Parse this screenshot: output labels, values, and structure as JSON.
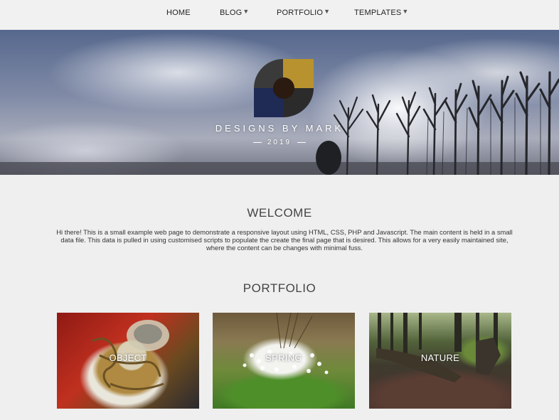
{
  "nav": {
    "items": [
      {
        "label": "HOME",
        "has_dropdown": false
      },
      {
        "label": "BLOG",
        "has_dropdown": true
      },
      {
        "label": "PORTFOLIO",
        "has_dropdown": true
      },
      {
        "label": "TEMPLATES",
        "has_dropdown": true
      }
    ],
    "dropdown_glyph": "▼"
  },
  "hero": {
    "brand": "DESIGNS BY MARK",
    "year": "2019",
    "logo_colors": [
      "#3a3a3a",
      "#b8922e",
      "#1f2a55",
      "#2b2b2b"
    ]
  },
  "welcome": {
    "title": "WELCOME",
    "text": "Hi there! This is a small example web page to demonstrate a responsive layout using HTML, CSS, PHP and Javascript. The main content is held in a small data file. This data is pulled in using customised scripts to populate the create the final page that is desired. This allows for a very easily maintained site, where the content can be changes with minimal fuss."
  },
  "portfolio": {
    "title": "PORTFOLIO",
    "cards": [
      {
        "label": "OBJECT"
      },
      {
        "label": "SPRING"
      },
      {
        "label": "NATURE"
      }
    ]
  }
}
